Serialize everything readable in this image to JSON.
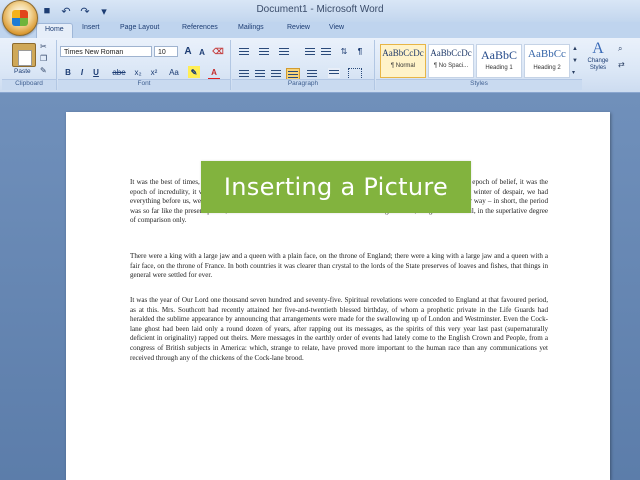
{
  "window": {
    "title": "Document1 - Microsoft Word"
  },
  "quick_access": {
    "save_icon": "save-icon",
    "undo_icon": "undo-icon",
    "redo_icon": "redo-icon"
  },
  "tabs": [
    "Home",
    "Insert",
    "Page Layout",
    "References",
    "Mailings",
    "Review",
    "View"
  ],
  "ribbon": {
    "clipboard": {
      "paste_label": "Paste",
      "group_label": "Clipboard"
    },
    "font": {
      "name": "Times New Roman",
      "size": "10",
      "group_label": "Font",
      "bold": "B",
      "italic": "I",
      "underline": "U",
      "strike": "abe",
      "sub": "x₂",
      "sup": "x²",
      "change_case": "Aa",
      "grow": "A",
      "shrink": "A"
    },
    "paragraph": {
      "group_label": "Paragraph",
      "show_marks": "¶"
    },
    "styles": {
      "group_label": "Styles",
      "items": [
        {
          "preview": "AaBbCcDc",
          "name": "¶ Normal",
          "selected": true
        },
        {
          "preview": "AaBbCcDc",
          "name": "¶ No Spaci...",
          "selected": false
        },
        {
          "preview": "AaBbC",
          "name": "Heading 1",
          "selected": false
        },
        {
          "preview": "AaBbCc",
          "name": "Heading 2",
          "selected": false
        }
      ],
      "change_label": "Change Styles"
    }
  },
  "overlay": {
    "title": "Inserting a Picture",
    "color": "#82b33e"
  },
  "document": {
    "paragraphs": [
      "It was the best of times, it was the worst of times, it was the age of wisdom, it was the age of foolishness, it was the epoch of belief, it was the epoch of incredulity, it was the season of Light, it was the season of Darkness, it was the spring of hope, it was the winter of despair, we had everything before us, we had nothing before us, we were all going direct to Heaven, we were all going direct the other way – in short, the period was so far like the present period, that some of its noisiest authorities insisted on its being received, for good or for evil, in the superlative degree of comparison only.",
      "There were a king with a large jaw and a queen with a plain face, on the throne of England; there were a king with a large jaw and a queen with a fair face, on the throne of France. In both countries it was clearer than crystal to the lords of the State preserves of loaves and fishes, that things in general were settled for ever.",
      "It was the year of Our Lord one thousand seven hundred and seventy-five. Spiritual revelations were conceded to England at that favoured period, as at this. Mrs. Southcott had recently attained her five-and-twentieth blessed birthday, of whom a prophetic private in the Life Guards had heralded the sublime appearance by announcing that arrangements were made for the swallowing up of London and Westminster. Even the Cock-lane ghost had been laid only a round dozen of years, after rapping out its messages, as the spirits of this very year last past (supernaturally deficient in originality) rapped out theirs. Mere messages in the earthly order of events had lately come to the English Crown and People, from a congress of British subjects in America: which, strange to relate, have proved more important to the human race than any communications yet received through any of the chickens of the Cock-lane brood."
    ]
  }
}
